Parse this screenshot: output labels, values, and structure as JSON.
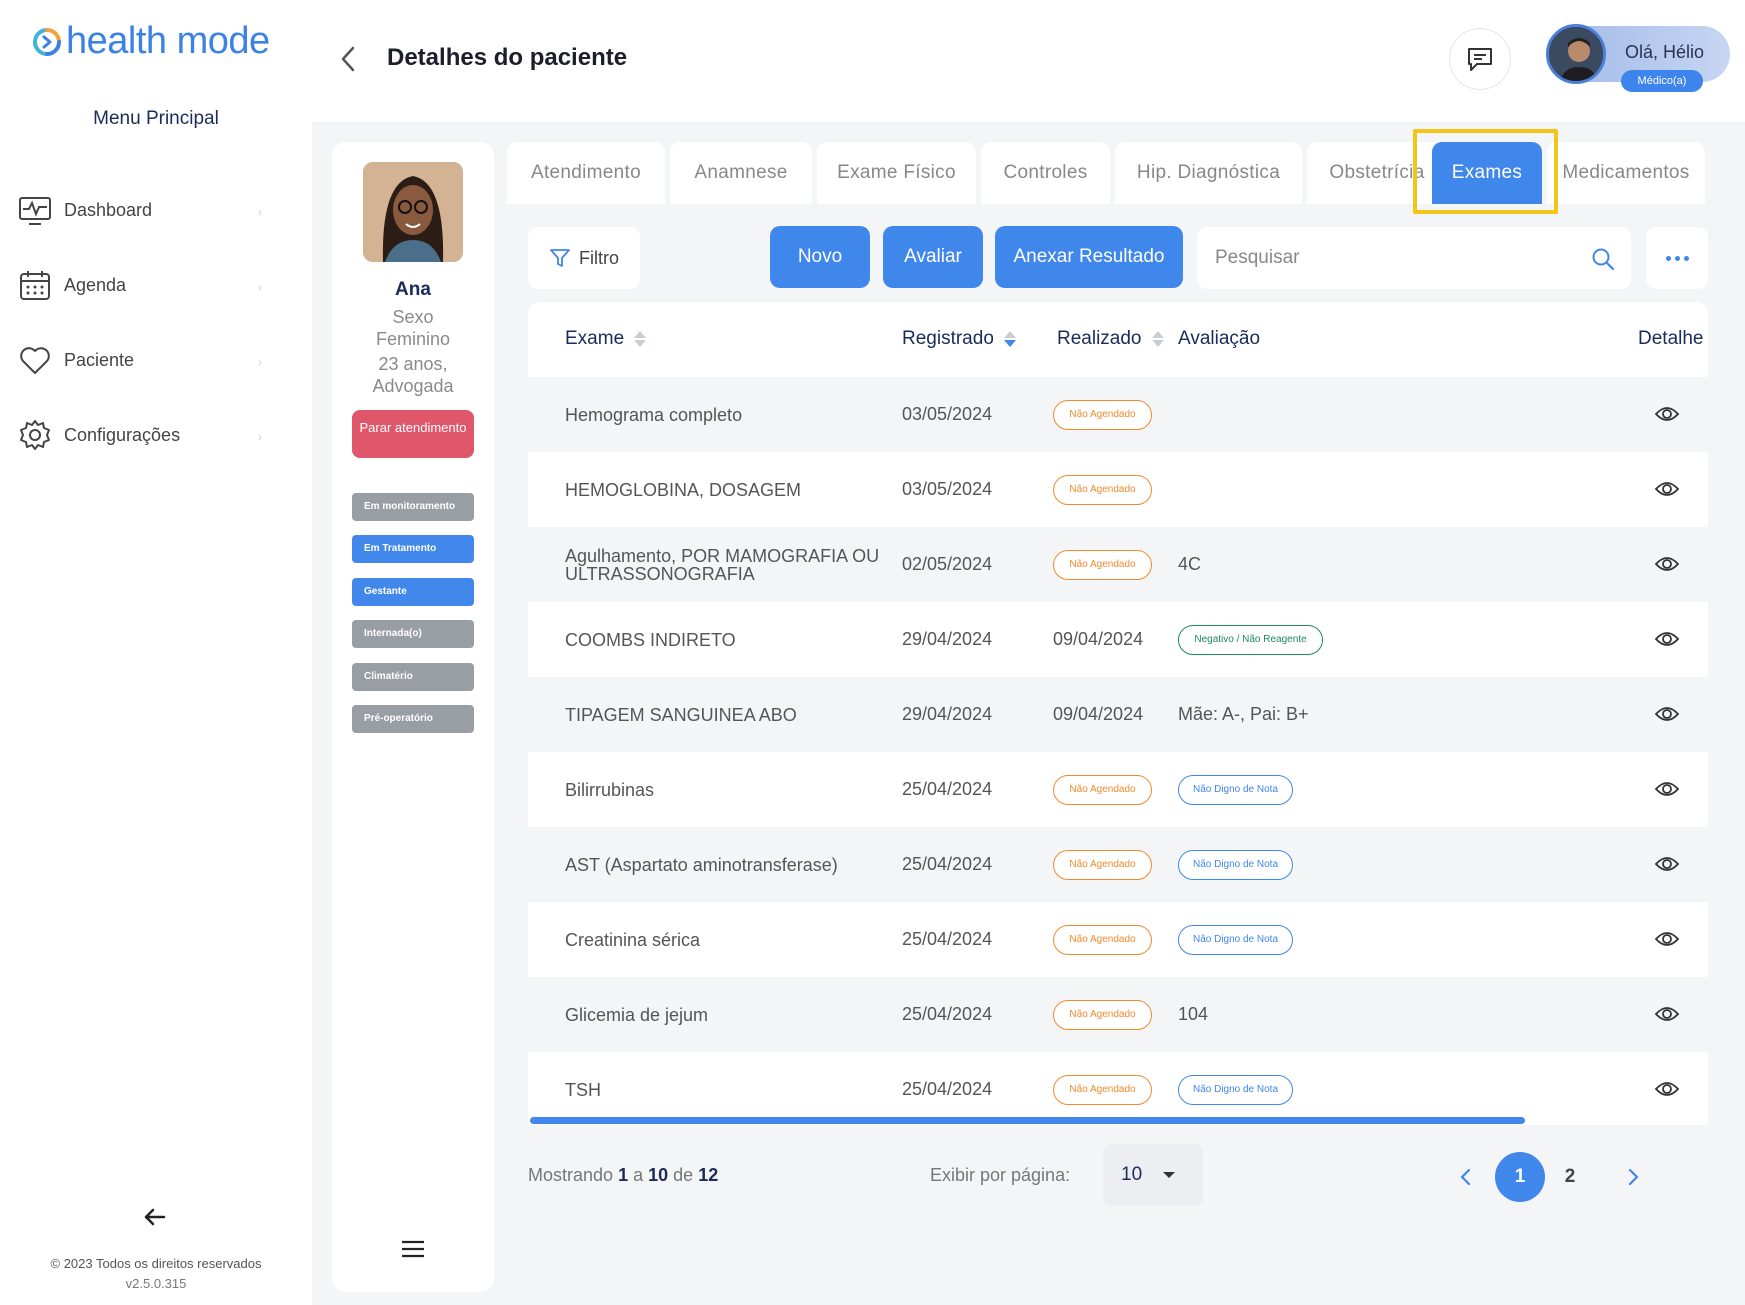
{
  "brand": {
    "name": "health mode"
  },
  "sidebar": {
    "title": "Menu Principal",
    "items": [
      {
        "label": "Dashboard",
        "icon": "monitor-icon"
      },
      {
        "label": "Agenda",
        "icon": "calendar-icon"
      },
      {
        "label": "Paciente",
        "icon": "heart-icon"
      },
      {
        "label": "Configurações",
        "icon": "gear-icon"
      }
    ],
    "footer": {
      "copyright": "© 2023 Todos os direitos reservados",
      "version": "v2.5.0.315"
    }
  },
  "header": {
    "title": "Detalhes do paciente",
    "user": {
      "greeting": "Olá, Hélio",
      "role": "Médico(a)"
    }
  },
  "patient": {
    "name": "Ana",
    "sex_label": "Sexo",
    "sex": "Feminino",
    "age": "23 anos,",
    "profession": "Advogada",
    "stop_button": "Parar atendimento",
    "tags": [
      {
        "label": "Em monitoramento",
        "active": false
      },
      {
        "label": "Em Tratamento",
        "active": true
      },
      {
        "label": "Gestante",
        "active": true
      },
      {
        "label": "Internada(o)",
        "active": false
      },
      {
        "label": "Climatério",
        "active": false
      },
      {
        "label": "Pré-operatório",
        "active": false
      }
    ]
  },
  "tabs": [
    {
      "label": "Atendimento"
    },
    {
      "label": "Anamnese"
    },
    {
      "label": "Exame Físico"
    },
    {
      "label": "Controles"
    },
    {
      "label": "Hip. Diagnóstica"
    },
    {
      "label": "Obstetrícia"
    },
    {
      "label": "Exames",
      "active": true
    },
    {
      "label": "Medicamentos"
    }
  ],
  "toolbar": {
    "filter": "Filtro",
    "new": "Novo",
    "evaluate": "Avaliar",
    "attach": "Anexar Resultado",
    "search_placeholder": "Pesquisar"
  },
  "table": {
    "columns": [
      "Exame",
      "Registrado",
      "Realizado",
      "Avaliação",
      "Detalhe"
    ],
    "rows": [
      {
        "exam": "Hemograma completo",
        "registered": "03/05/2024",
        "done": "Não Agendado",
        "done_badge": true,
        "evaluation": "",
        "eval_type": "none"
      },
      {
        "exam": "HEMOGLOBINA, DOSAGEM",
        "registered": "03/05/2024",
        "done": "Não Agendado",
        "done_badge": true,
        "evaluation": "",
        "eval_type": "none"
      },
      {
        "exam": "Agulhamento, POR MAMOGRAFIA OU ULTRASSONOGRAFIA",
        "registered": "02/05/2024",
        "done": "Não Agendado",
        "done_badge": true,
        "evaluation": "4C",
        "eval_type": "text"
      },
      {
        "exam": "COOMBS INDIRETO",
        "registered": "29/04/2024",
        "done": "09/04/2024",
        "done_badge": false,
        "evaluation": "Negativo / Não Reagente",
        "eval_type": "green"
      },
      {
        "exam": "TIPAGEM SANGUINEA ABO",
        "registered": "29/04/2024",
        "done": "09/04/2024",
        "done_badge": false,
        "evaluation": "Mãe: A-, Pai: B+",
        "eval_type": "text"
      },
      {
        "exam": "Bilirrubinas",
        "registered": "25/04/2024",
        "done": "Não Agendado",
        "done_badge": true,
        "evaluation": "Não Digno de Nota",
        "eval_type": "blue"
      },
      {
        "exam": "AST (Aspartato aminotransferase)",
        "registered": "25/04/2024",
        "done": "Não Agendado",
        "done_badge": true,
        "evaluation": "Não Digno de Nota",
        "eval_type": "blue"
      },
      {
        "exam": "Creatinina sérica",
        "registered": "25/04/2024",
        "done": "Não Agendado",
        "done_badge": true,
        "evaluation": "Não Digno de Nota",
        "eval_type": "blue"
      },
      {
        "exam": "Glicemia de jejum",
        "registered": "25/04/2024",
        "done": "Não Agendado",
        "done_badge": true,
        "evaluation": "104",
        "eval_type": "text"
      },
      {
        "exam": "TSH",
        "registered": "25/04/2024",
        "done": "Não Agendado",
        "done_badge": true,
        "evaluation": "Não Digno de Nota",
        "eval_type": "blue"
      }
    ]
  },
  "pagination": {
    "showing_prefix": "Mostrando",
    "from": "1",
    "to_word": "a",
    "to": "10",
    "of_word": "de",
    "total": "12",
    "per_page_label": "Exibir por página:",
    "per_page": "10",
    "pages": [
      "1",
      "2"
    ],
    "current_page": "1"
  },
  "colors": {
    "accent": "#3f87eb",
    "danger": "#e0566a",
    "highlight": "#f2c518",
    "warning": "#f08a2c",
    "success": "#1f8a5a"
  }
}
